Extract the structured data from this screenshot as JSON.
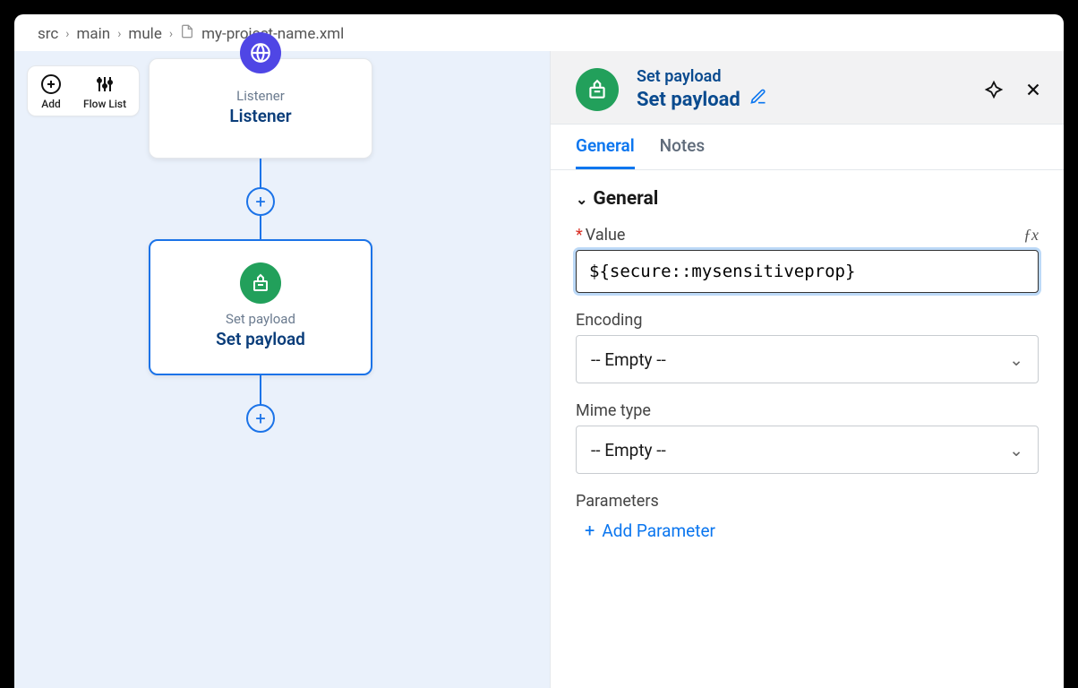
{
  "breadcrumb": {
    "parts": [
      "src",
      "main",
      "mule"
    ],
    "file": "my-project-name.xml"
  },
  "toolbar": {
    "add": "Add",
    "flowlist": "Flow List"
  },
  "nodes": {
    "listener": {
      "sub": "Listener",
      "name": "Listener"
    },
    "setpayload": {
      "sub": "Set payload",
      "name": "Set payload"
    }
  },
  "panel": {
    "type": "Set payload",
    "title": "Set payload",
    "tabs": {
      "general": "General",
      "notes": "Notes"
    },
    "section": "General",
    "value_label": "Value",
    "value": "${secure::mysensitiveprop}",
    "encoding_label": "Encoding",
    "encoding_value": "-- Empty --",
    "mime_label": "Mime type",
    "mime_value": "-- Empty --",
    "parameters_label": "Parameters",
    "add_parameter": "Add Parameter"
  }
}
